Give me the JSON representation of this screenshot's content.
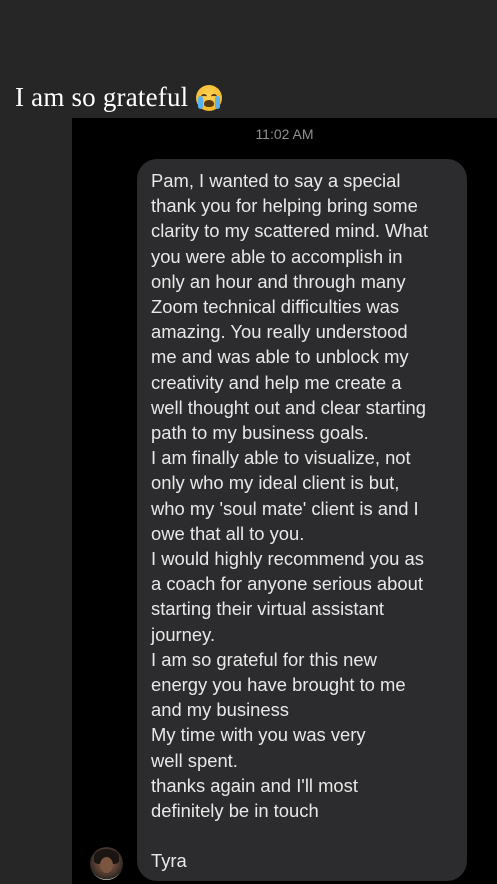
{
  "caption": {
    "text": "I am so grateful",
    "emoji": "crying-face-emoji"
  },
  "chat": {
    "timestamp": "11:02 AM",
    "message_lines": [
      "Pam, I wanted to say a special",
      "thank you for helping bring some",
      "clarity to my scattered mind. What",
      "you were able to accomplish in",
      "only an hour and through many",
      "Zoom technical difficulties was",
      "amazing. You really understood",
      "me and was able to unblock my",
      "creativity and help me create a",
      "well thought out and clear starting",
      "path to my business goals.",
      "I am finally able to visualize, not",
      "only who my ideal client is but,",
      "who my 'soul mate' client is and I",
      "owe that all to you.",
      "I would highly recommend you as",
      "a coach for anyone serious about",
      "starting their virtual assistant",
      "journey.",
      "I am so grateful for this new",
      "energy you have brought to me",
      "and my business",
      "My time with you was very",
      "well spent.",
      "thanks again  and I'll most",
      "definitely be in touch",
      "",
      "Tyra"
    ],
    "sender_avatar": "avatar-photo"
  },
  "colors": {
    "page_background": "#262626",
    "screenshot_background": "#000000",
    "bubble_background": "#2c2c2e",
    "text": "#e8e8e8",
    "timestamp": "#8e8e93"
  }
}
